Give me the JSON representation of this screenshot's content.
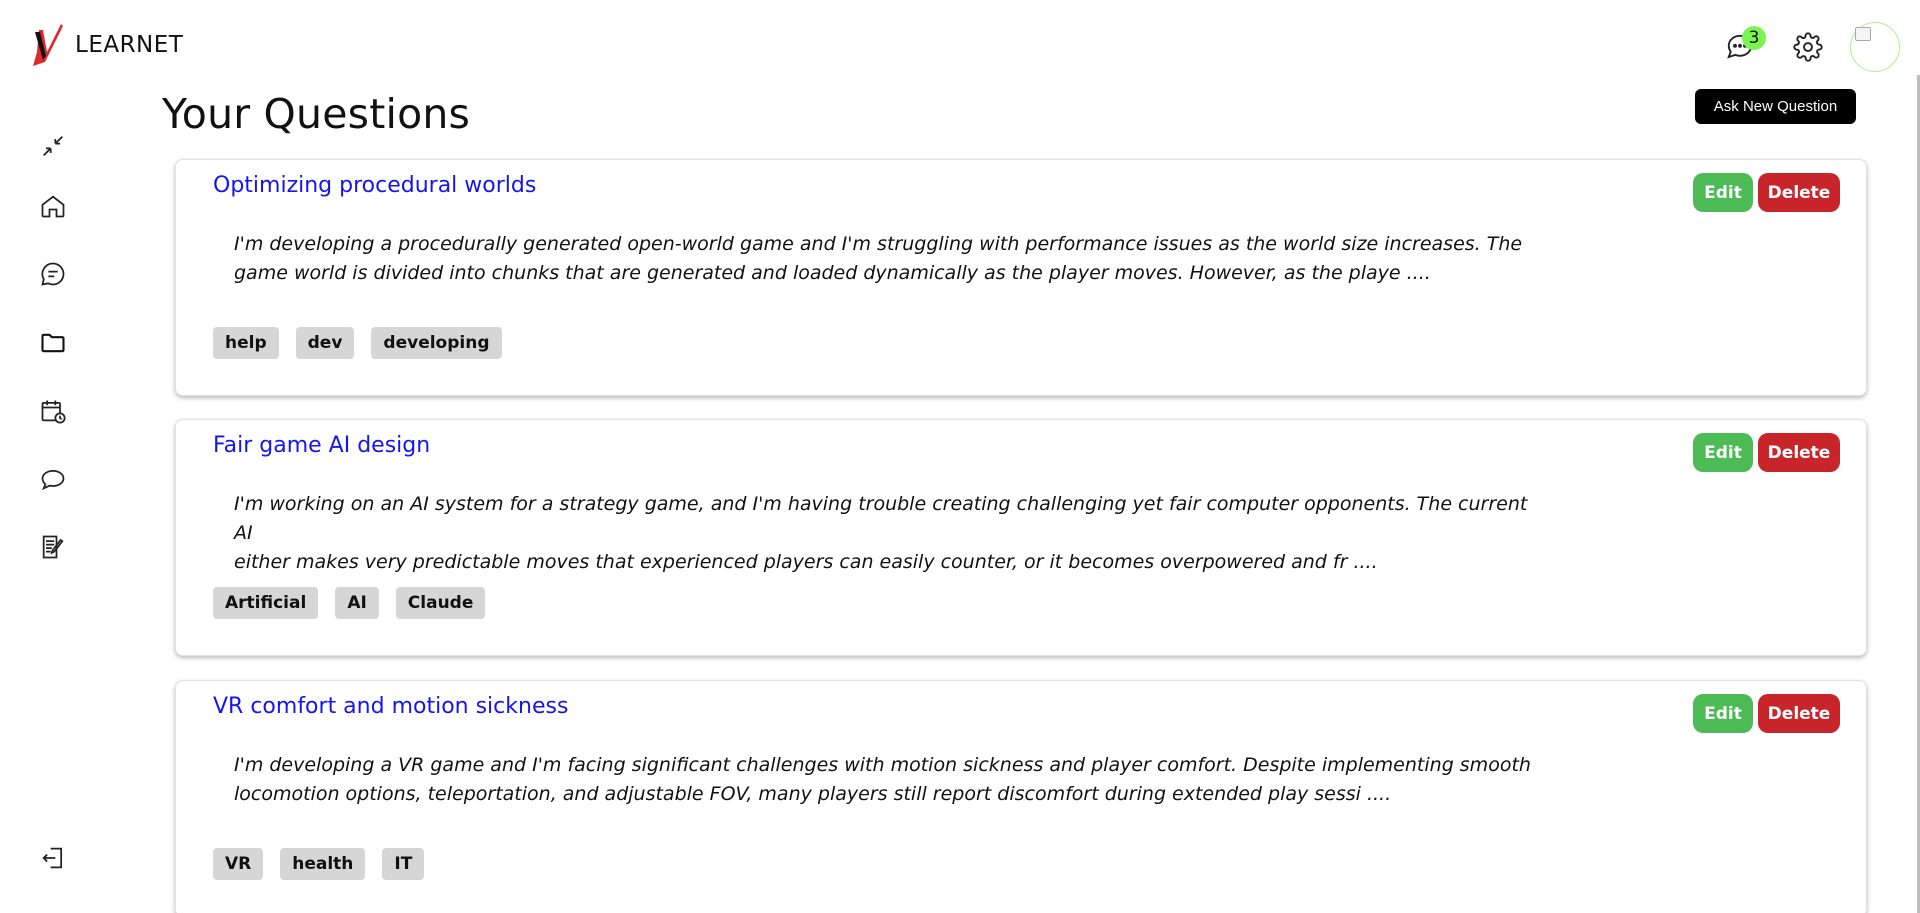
{
  "app": {
    "brand_name": "LEARNET"
  },
  "header": {
    "notification_count": "3",
    "icons": [
      "chat-bubble-icon",
      "gear-icon",
      "avatar"
    ]
  },
  "sidebar": {
    "items": [
      {
        "icon": "collapse-icon"
      },
      {
        "icon": "home-icon"
      },
      {
        "icon": "message-icon"
      },
      {
        "icon": "folder-icon"
      },
      {
        "icon": "calendar-clock-icon"
      },
      {
        "icon": "chat-icon"
      },
      {
        "icon": "notes-edit-icon"
      },
      {
        "icon": "logout-icon"
      }
    ]
  },
  "main": {
    "title": "Your Questions",
    "ask_button": "Ask New Question",
    "edit_label": "Edit",
    "delete_label": "Delete",
    "questions": [
      {
        "title": "Optimizing procedural worlds",
        "body_line1": "I'm developing a procedurally generated open-world game and I'm struggling with performance issues as the world size increases. The",
        "body_line2": "game world is divided into chunks that are generated and loaded dynamically as the player moves. However, as the playe ....",
        "tags": [
          "help",
          "dev",
          "developing"
        ]
      },
      {
        "title": "Fair game AI design",
        "body_line1": "I'm working on an AI system for a strategy game, and I'm having trouble creating challenging yet fair computer opponents. The current AI",
        "body_line2": "either makes very predictable moves that experienced players can easily counter, or it becomes overpowered and fr ....",
        "tags": [
          "Artificial",
          "AI",
          "Claude"
        ]
      },
      {
        "title": "VR comfort and motion sickness",
        "body_line1": "I'm developing a VR game and I'm facing significant challenges with motion sickness and player comfort. Despite implementing smooth",
        "body_line2": "locomotion options, teleportation, and adjustable FOV, many players still report discomfort during extended play sessi ....",
        "tags": [
          "VR",
          "health",
          "IT"
        ]
      }
    ]
  },
  "colors": {
    "title_link": "#1515ee",
    "edit_button": "#4cbb55",
    "delete_button": "#c8252b",
    "badge": "#7cf253",
    "tag_bg": "#d6d6d6",
    "logo_red": "#e0282e"
  }
}
